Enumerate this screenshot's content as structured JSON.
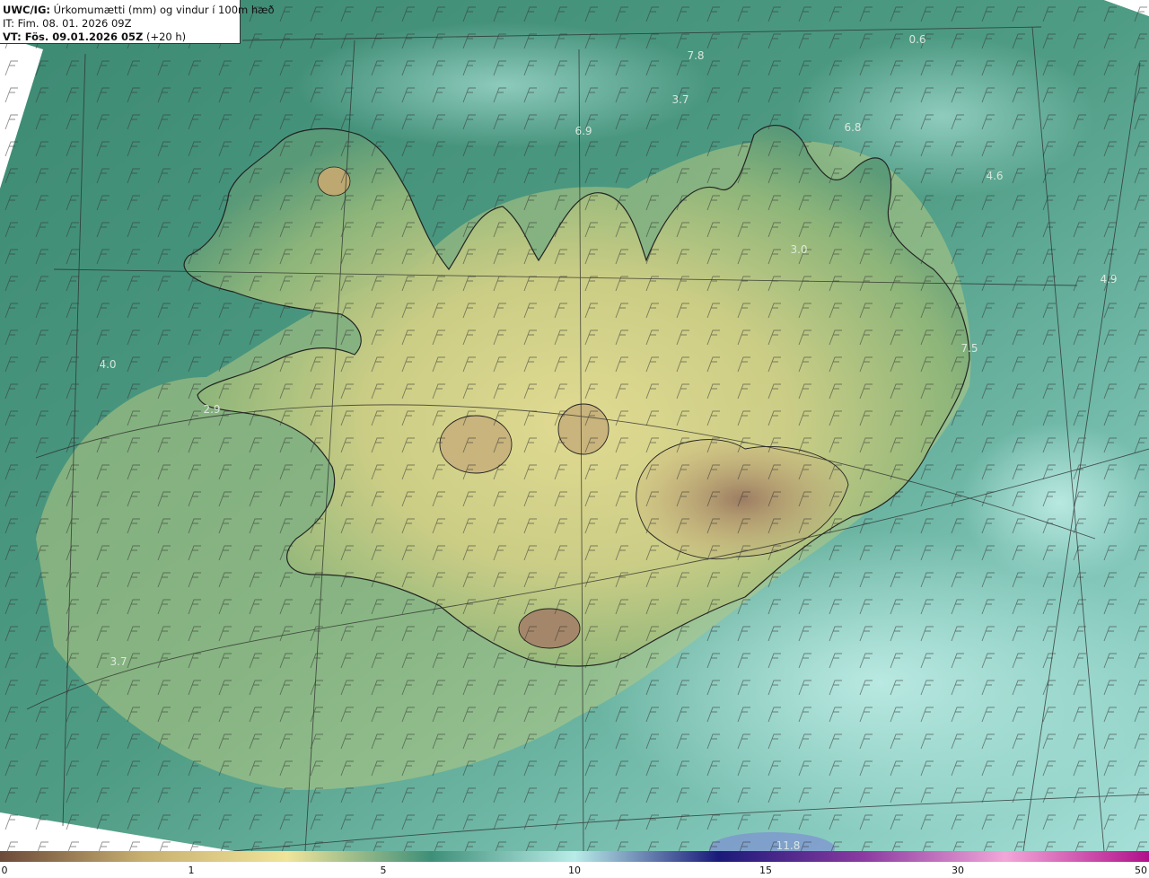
{
  "header": {
    "model": "UWC/IG:",
    "description": "Úrkomumætti (mm) og vindur í 100m hæð",
    "it_line": "IT: Fim. 08. 01. 2026 09Z",
    "vt_prefix": "VT: Fös. 09.01.2026 05Z",
    "vt_suffix": "(+20 h)"
  },
  "values_on_map": [
    {
      "id": "v1",
      "text": "7.8"
    },
    {
      "id": "v2",
      "text": "3.7"
    },
    {
      "id": "v3",
      "text": "6.9"
    },
    {
      "id": "v4",
      "text": "6.8"
    },
    {
      "id": "v5",
      "text": "4.6"
    },
    {
      "id": "v6",
      "text": "3.0"
    },
    {
      "id": "v7",
      "text": "4.9"
    },
    {
      "id": "v8",
      "text": "7.5"
    },
    {
      "id": "v9",
      "text": "4.0"
    },
    {
      "id": "v10",
      "text": "2.9"
    },
    {
      "id": "v11",
      "text": "3.7"
    },
    {
      "id": "v12",
      "text": "11.8"
    },
    {
      "id": "v13",
      "text": "0.6"
    }
  ],
  "colorbar": {
    "ticks": [
      "0",
      "1",
      "5",
      "10",
      "15",
      "30",
      "50"
    ],
    "colors": [
      "#6b4a3a",
      "#c8b070",
      "#f0e49a",
      "#3e8f78",
      "#b9ece8",
      "#1a1a7a",
      "#8a3aa0",
      "#f2a6d8",
      "#b0108a"
    ]
  },
  "colors": {
    "sea_dark": "#2f7a66",
    "sea_mid": "#4f9a82",
    "sea_light": "#9fdcd4",
    "land_green": "#6fa873",
    "land_yellow": "#dcd68c",
    "land_brown": "#a88a6a"
  }
}
